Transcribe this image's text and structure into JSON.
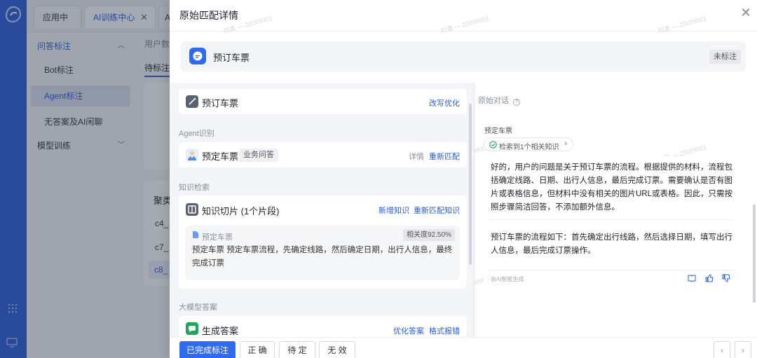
{
  "tabs": {
    "app_center": "应用中心",
    "ai_training": "AI训练中心",
    "more": "A"
  },
  "menu": {
    "qa_group": "问答标注",
    "bot": "Bot标注",
    "agent": "Agent标注",
    "no_answer": "无答案及AI闲聊",
    "model_train": "模型训练"
  },
  "background": {
    "user_data": "用户数",
    "pending_tab": "待标注",
    "cluster": "聚类",
    "c4": "c4_",
    "c7": "c7_",
    "c8": "c8_"
  },
  "drawer": {
    "title": "原始匹配详情",
    "header_title": "预订车票",
    "header_badge": "未标注",
    "rewrite_card": {
      "title": "预订车票",
      "action": "改写优化"
    },
    "agent_section": "Agent识别",
    "agent_card": {
      "title": "预定车票",
      "tag": "业务问答",
      "detail": "详情",
      "rematch": "重新匹配"
    },
    "knowledge_section": "知识检索",
    "knowledge_card": {
      "title": "知识切片 (1个片段)",
      "add": "新增知识",
      "rematch": "重新匹配知识",
      "chunk_title": "预定车票",
      "relevance": "相关度92.50%",
      "chunk_text": "预定车票 预定车票流程，先确定线路，然后确定日期，出行人信息，最终完成订票"
    },
    "llm_section": "大模型答案",
    "answer_card": {
      "title": "生成答案",
      "optimize": "优化答案",
      "format_error": "格式报错"
    },
    "original_dialog": {
      "label": "原始对话",
      "question": "预定车票",
      "retrieval_chip": "检索到1个相关知识",
      "thought": "好的，用户的问题是关于预订车票的流程。根据提供的材料，流程包括确定线路、日期、出行人信息，最后完成订票。需要确认是否有图片或表格信息，但材料中没有相关的图片URL或表格。因此，只需按照步骤简洁回答，不添加额外信息。",
      "answer": "预订车票的流程如下：首先确定出行线路，然后选择日期，填写出行人信息，最后完成订票操作。",
      "ai_note": "由AI智能生成"
    },
    "footer": {
      "done": "已完成标注",
      "correct": "正 确",
      "pending": "待 定",
      "invalid": "无 效"
    },
    "watermark": "刘逸 — 20099001"
  }
}
